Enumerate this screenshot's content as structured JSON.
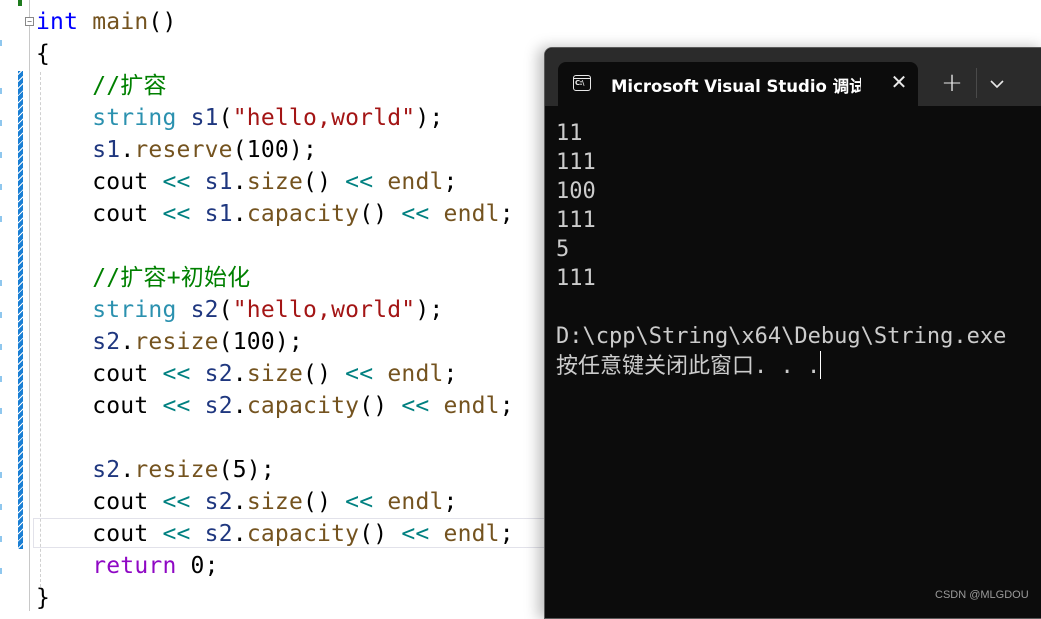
{
  "editor": {
    "lines": [
      {
        "tokens": [
          {
            "t": "int",
            "c": "kw"
          },
          {
            "t": " ",
            "c": "plain"
          },
          {
            "t": "main",
            "c": "fn"
          },
          {
            "t": "()",
            "c": "plain"
          }
        ]
      },
      {
        "tokens": [
          {
            "t": "{",
            "c": "plain"
          }
        ]
      },
      {
        "tokens": [
          {
            "t": "    ",
            "c": "plain"
          },
          {
            "t": "//扩容",
            "c": "cmt"
          }
        ]
      },
      {
        "tokens": [
          {
            "t": "    ",
            "c": "plain"
          },
          {
            "t": "string",
            "c": "type"
          },
          {
            "t": " ",
            "c": "plain"
          },
          {
            "t": "s1",
            "c": "var"
          },
          {
            "t": "(",
            "c": "plain"
          },
          {
            "t": "\"hello,world\"",
            "c": "str"
          },
          {
            "t": ");",
            "c": "plain"
          }
        ]
      },
      {
        "tokens": [
          {
            "t": "    ",
            "c": "plain"
          },
          {
            "t": "s1",
            "c": "var"
          },
          {
            "t": ".",
            "c": "plain"
          },
          {
            "t": "reserve",
            "c": "fn"
          },
          {
            "t": "(100);",
            "c": "plain"
          }
        ]
      },
      {
        "tokens": [
          {
            "t": "    ",
            "c": "plain"
          },
          {
            "t": "cout",
            "c": "plain"
          },
          {
            "t": " ",
            "c": "plain"
          },
          {
            "t": "<<",
            "c": "op"
          },
          {
            "t": " ",
            "c": "plain"
          },
          {
            "t": "s1",
            "c": "var"
          },
          {
            "t": ".",
            "c": "plain"
          },
          {
            "t": "size",
            "c": "fn"
          },
          {
            "t": "() ",
            "c": "plain"
          },
          {
            "t": "<<",
            "c": "op"
          },
          {
            "t": " ",
            "c": "plain"
          },
          {
            "t": "endl",
            "c": "fn"
          },
          {
            "t": ";",
            "c": "plain"
          }
        ]
      },
      {
        "tokens": [
          {
            "t": "    ",
            "c": "plain"
          },
          {
            "t": "cout",
            "c": "plain"
          },
          {
            "t": " ",
            "c": "plain"
          },
          {
            "t": "<<",
            "c": "op"
          },
          {
            "t": " ",
            "c": "plain"
          },
          {
            "t": "s1",
            "c": "var"
          },
          {
            "t": ".",
            "c": "plain"
          },
          {
            "t": "capacity",
            "c": "fn"
          },
          {
            "t": "() ",
            "c": "plain"
          },
          {
            "t": "<<",
            "c": "op"
          },
          {
            "t": " ",
            "c": "plain"
          },
          {
            "t": "endl",
            "c": "fn"
          },
          {
            "t": ";",
            "c": "plain"
          }
        ]
      },
      {
        "tokens": []
      },
      {
        "tokens": [
          {
            "t": "    ",
            "c": "plain"
          },
          {
            "t": "//扩容+初始化",
            "c": "cmt"
          }
        ]
      },
      {
        "tokens": [
          {
            "t": "    ",
            "c": "plain"
          },
          {
            "t": "string",
            "c": "type"
          },
          {
            "t": " ",
            "c": "plain"
          },
          {
            "t": "s2",
            "c": "var"
          },
          {
            "t": "(",
            "c": "plain"
          },
          {
            "t": "\"hello,world\"",
            "c": "str"
          },
          {
            "t": ");",
            "c": "plain"
          }
        ]
      },
      {
        "tokens": [
          {
            "t": "    ",
            "c": "plain"
          },
          {
            "t": "s2",
            "c": "var"
          },
          {
            "t": ".",
            "c": "plain"
          },
          {
            "t": "resize",
            "c": "fn"
          },
          {
            "t": "(100);",
            "c": "plain"
          }
        ]
      },
      {
        "tokens": [
          {
            "t": "    ",
            "c": "plain"
          },
          {
            "t": "cout",
            "c": "plain"
          },
          {
            "t": " ",
            "c": "plain"
          },
          {
            "t": "<<",
            "c": "op"
          },
          {
            "t": " ",
            "c": "plain"
          },
          {
            "t": "s2",
            "c": "var"
          },
          {
            "t": ".",
            "c": "plain"
          },
          {
            "t": "size",
            "c": "fn"
          },
          {
            "t": "() ",
            "c": "plain"
          },
          {
            "t": "<<",
            "c": "op"
          },
          {
            "t": " ",
            "c": "plain"
          },
          {
            "t": "endl",
            "c": "fn"
          },
          {
            "t": ";",
            "c": "plain"
          }
        ]
      },
      {
        "tokens": [
          {
            "t": "    ",
            "c": "plain"
          },
          {
            "t": "cout",
            "c": "plain"
          },
          {
            "t": " ",
            "c": "plain"
          },
          {
            "t": "<<",
            "c": "op"
          },
          {
            "t": " ",
            "c": "plain"
          },
          {
            "t": "s2",
            "c": "var"
          },
          {
            "t": ".",
            "c": "plain"
          },
          {
            "t": "capacity",
            "c": "fn"
          },
          {
            "t": "() ",
            "c": "plain"
          },
          {
            "t": "<<",
            "c": "op"
          },
          {
            "t": " ",
            "c": "plain"
          },
          {
            "t": "endl",
            "c": "fn"
          },
          {
            "t": ";",
            "c": "plain"
          }
        ]
      },
      {
        "tokens": []
      },
      {
        "tokens": [
          {
            "t": "    ",
            "c": "plain"
          },
          {
            "t": "s2",
            "c": "var"
          },
          {
            "t": ".",
            "c": "plain"
          },
          {
            "t": "resize",
            "c": "fn"
          },
          {
            "t": "(5);",
            "c": "plain"
          }
        ]
      },
      {
        "tokens": [
          {
            "t": "    ",
            "c": "plain"
          },
          {
            "t": "cout",
            "c": "plain"
          },
          {
            "t": " ",
            "c": "plain"
          },
          {
            "t": "<<",
            "c": "op"
          },
          {
            "t": " ",
            "c": "plain"
          },
          {
            "t": "s2",
            "c": "var"
          },
          {
            "t": ".",
            "c": "plain"
          },
          {
            "t": "size",
            "c": "fn"
          },
          {
            "t": "() ",
            "c": "plain"
          },
          {
            "t": "<<",
            "c": "op"
          },
          {
            "t": " ",
            "c": "plain"
          },
          {
            "t": "endl",
            "c": "fn"
          },
          {
            "t": ";",
            "c": "plain"
          }
        ]
      },
      {
        "tokens": [
          {
            "t": "    ",
            "c": "plain"
          },
          {
            "t": "cout",
            "c": "plain"
          },
          {
            "t": " ",
            "c": "plain"
          },
          {
            "t": "<<",
            "c": "op"
          },
          {
            "t": " ",
            "c": "plain"
          },
          {
            "t": "s2",
            "c": "var"
          },
          {
            "t": ".",
            "c": "plain"
          },
          {
            "t": "capacity",
            "c": "fn"
          },
          {
            "t": "() ",
            "c": "plain"
          },
          {
            "t": "<<",
            "c": "op"
          },
          {
            "t": " ",
            "c": "plain"
          },
          {
            "t": "endl",
            "c": "fn"
          },
          {
            "t": ";",
            "c": "plain"
          }
        ]
      },
      {
        "tokens": [
          {
            "t": "    ",
            "c": "plain"
          },
          {
            "t": "return",
            "c": "ctl"
          },
          {
            "t": " 0;",
            "c": "plain"
          }
        ]
      },
      {
        "tokens": [
          {
            "t": "}",
            "c": "plain"
          }
        ]
      }
    ],
    "fold_glyph": "⊟"
  },
  "terminal": {
    "tab_icon_text": "C:\\",
    "tab_title": "Microsoft Visual Studio 调试控制台",
    "close_glyph": "✕",
    "new_tab_glyph": "+",
    "output_lines": [
      "11",
      "111",
      "100",
      "111",
      "5",
      "111",
      "",
      "D:\\cpp\\String\\x64\\Debug\\String.exe",
      "按任意键关闭此窗口. . ."
    ],
    "watermark": "CSDN @MLGDOU"
  },
  "colors": {
    "keyword": "#0000ff",
    "function": "#74531f",
    "type": "#2b91af",
    "variable": "#1f377f",
    "string": "#a31515",
    "comment": "#008000",
    "operator": "#008080",
    "control": "#8f08c4",
    "terminal_bg": "#0c0c0c",
    "terminal_text": "#cccccc"
  }
}
